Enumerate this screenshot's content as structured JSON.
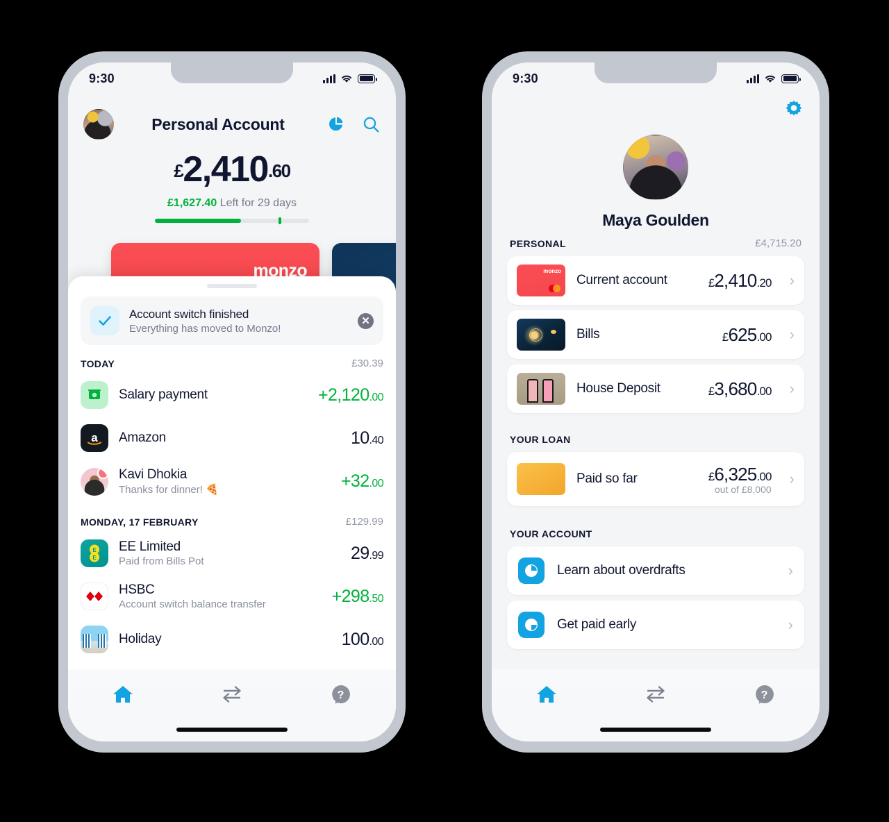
{
  "theme": {
    "accent_blue": "#12a3e0",
    "green": "#00b23c",
    "navy": "#10162f",
    "coral": "#fb4e54",
    "muted": "#9298a8",
    "frame": "#c3c7d0",
    "background": "#000000"
  },
  "left_phone": {
    "status_bar": {
      "time": "9:30",
      "signal_icon": "cellular-bars-icon",
      "wifi_icon": "wifi-icon",
      "battery_icon": "battery-icon"
    },
    "header": {
      "avatar_name": "profile-avatar",
      "title": "Personal Account",
      "pie_icon": "pie-chart-icon",
      "search_icon": "search-icon"
    },
    "balance": {
      "currency": "£",
      "main": "2,410",
      "decimals": ".60",
      "left_amount": "£1,627.40",
      "left_label": "Left for 29 days",
      "progress_percent": 56,
      "marker_percent": 80
    },
    "cards": {
      "primary_label": "monzo",
      "secondary_label": ""
    },
    "banner": {
      "icon": "check-icon",
      "title": "Account switch finished",
      "subtitle": "Everything has moved to Monzo!",
      "close_icon": "close-icon"
    },
    "groups": [
      {
        "label": "TODAY",
        "total": "£30.39",
        "transactions": [
          {
            "icon": "salary-icon",
            "name": "Salary payment",
            "subtitle": "",
            "amount": "+2,120",
            "decimals": ".00",
            "positive": true
          },
          {
            "icon": "amazon-icon",
            "name": "Amazon",
            "subtitle": "",
            "amount": "10",
            "decimals": ".40",
            "positive": false
          },
          {
            "icon": "person-icon",
            "name": "Kavi Dhokia",
            "subtitle": "Thanks for dinner! 🍕",
            "amount": "+32",
            "decimals": ".00",
            "positive": true
          }
        ]
      },
      {
        "label": "MONDAY, 17 FEBRUARY",
        "total": "£129.99",
        "transactions": [
          {
            "icon": "ee-icon",
            "name": "EE Limited",
            "subtitle": "Paid from Bills Pot",
            "amount": "29",
            "decimals": ".99",
            "positive": false
          },
          {
            "icon": "hsbc-icon",
            "name": "HSBC",
            "subtitle": "Account switch balance transfer",
            "amount": "+298",
            "decimals": ".50",
            "positive": true
          },
          {
            "icon": "holiday-icon",
            "name": "Holiday",
            "subtitle": "",
            "amount": "100",
            "decimals": ".00",
            "positive": false
          }
        ]
      }
    ],
    "tabs": [
      {
        "name": "home-tab",
        "icon": "home-icon",
        "active": true
      },
      {
        "name": "payments-tab",
        "icon": "transfer-arrows-icon",
        "active": false
      },
      {
        "name": "help-tab",
        "icon": "help-question-icon",
        "active": false
      }
    ]
  },
  "right_phone": {
    "status_bar": {
      "time": "9:30",
      "signal_icon": "cellular-bars-icon",
      "wifi_icon": "wifi-icon",
      "battery_icon": "battery-icon"
    },
    "settings_icon": "gear-icon",
    "profile": {
      "avatar": "profile-avatar-large",
      "name": "Maya Goulden"
    },
    "sections": [
      {
        "label": "PERSONAL",
        "total": "£4,715.20",
        "items": [
          {
            "thumb": "monzo-card-thumb",
            "name": "Current account",
            "currency": "£",
            "amount": "2,410",
            "decimals": ".20",
            "subtitle": "",
            "chevron": "chevron-right-icon"
          },
          {
            "thumb": "lightbulb-thumb",
            "name": "Bills",
            "currency": "£",
            "amount": "625",
            "decimals": ".00",
            "subtitle": "",
            "chevron": "chevron-right-icon"
          },
          {
            "thumb": "house-doors-thumb",
            "name": "House Deposit",
            "currency": "£",
            "amount": "3,680",
            "decimals": ".00",
            "subtitle": "",
            "chevron": "chevron-right-icon"
          }
        ]
      },
      {
        "label": "YOUR LOAN",
        "total": "",
        "items": [
          {
            "thumb": "loan-thumb",
            "name": "Paid so far",
            "currency": "£",
            "amount": "6,325",
            "decimals": ".00",
            "subtitle": "out of £8,000",
            "chevron": "chevron-right-icon"
          }
        ]
      }
    ],
    "account_section": {
      "label": "YOUR ACCOUNT",
      "links": [
        {
          "icon": "clock-icon",
          "label": "Learn about overdrafts",
          "chevron": "chevron-right-icon"
        },
        {
          "icon": "clock-icon",
          "label": "Get paid early",
          "chevron": "chevron-right-icon"
        }
      ]
    },
    "tabs": [
      {
        "name": "home-tab",
        "icon": "home-icon",
        "active": true
      },
      {
        "name": "payments-tab",
        "icon": "transfer-arrows-icon",
        "active": false
      },
      {
        "name": "help-tab",
        "icon": "help-question-icon",
        "active": false
      }
    ]
  }
}
